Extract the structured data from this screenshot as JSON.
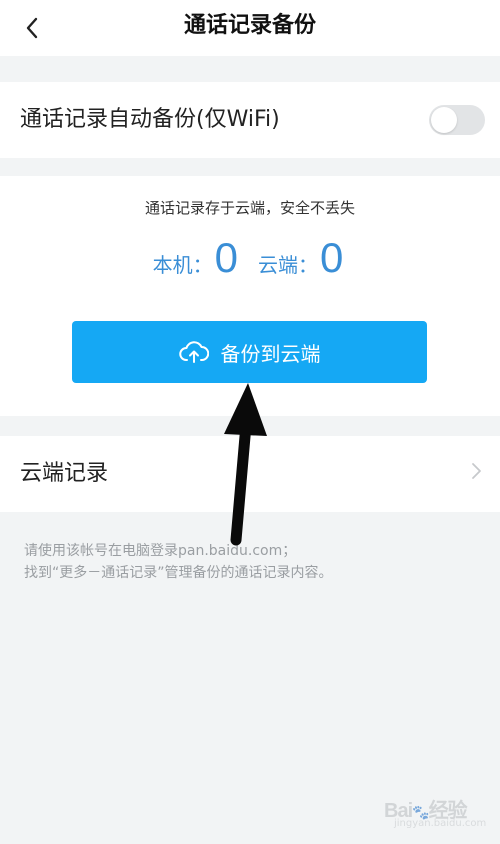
{
  "header": {
    "title": "通话记录备份",
    "back_icon": "chevron-left-icon"
  },
  "auto_backup": {
    "label": "通话记录自动备份(仅WiFi)",
    "enabled": false
  },
  "panel": {
    "note": "通话记录存于云端，安全不丢失",
    "local_label": "本机：",
    "local_count": "0",
    "cloud_label": "云端：",
    "cloud_count": "0",
    "backup_button_label": "备份到云端",
    "backup_icon": "cloud-upload-icon"
  },
  "cloud_records": {
    "label": "云端记录",
    "chevron_icon": "chevron-right-icon"
  },
  "footnote": {
    "line1": "请使用该帐号在电脑登录pan.baidu.com；",
    "line2": "找到“更多－通话记录”管理备份的通话记录内容。"
  },
  "colors": {
    "accent": "#15a8f4",
    "count_text": "#3a8ed6",
    "background": "#f2f4f5"
  }
}
